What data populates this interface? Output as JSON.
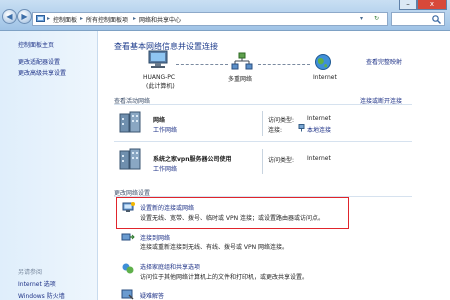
{
  "addressbar": {
    "crumb1": "控制面板",
    "crumb2": "所有控制面板项",
    "crumb3": "网络和共享中心"
  },
  "window": {
    "minimize": "–",
    "close": "x"
  },
  "nav": {
    "back": "◀",
    "forward": "▶"
  },
  "sidebar": {
    "home": "控制面板主页",
    "adapter": "更改适配器设置",
    "sharing": "更改高级共享设置",
    "see_also": "另请参阅",
    "internet_options": "Internet 选项",
    "firewall": "Windows 防火墙"
  },
  "main": {
    "title": "查看基本网络信息并设置连接",
    "full_map": "查看完整映射",
    "map": {
      "computer_name": "HUANG-PC",
      "computer_sub": "(此计算机)",
      "multi_network": "多重网络",
      "internet": "Internet"
    },
    "active_header": "查看活动网络",
    "connect_disconnect": "连接或断开连接",
    "networks": [
      {
        "name": "网络",
        "type": "工作网络",
        "access_label": "访问类型:",
        "access_value": "Internet",
        "conn_label": "连接:",
        "conn_value": "本地连接"
      },
      {
        "name": "系统之家vpn服务器公司使用",
        "type": "工作网络",
        "access_label": "访问类型:",
        "access_value": "Internet"
      }
    ],
    "change_header": "更改网络设置",
    "tasks": [
      {
        "title": "设置新的连接或网络",
        "desc": "设置无线、宽带、拨号、临时或 VPN 连接；或设置路由器或访问点。"
      },
      {
        "title": "连接到网络",
        "desc": "连接或重新连接到无线、有线、拨号或 VPN 网络连接。"
      },
      {
        "title": "选择家庭组和共享选项",
        "desc": "访问位于其他网络计算机上的文件和打印机，或更改共享设置。"
      },
      {
        "title": "疑难解答"
      }
    ]
  }
}
